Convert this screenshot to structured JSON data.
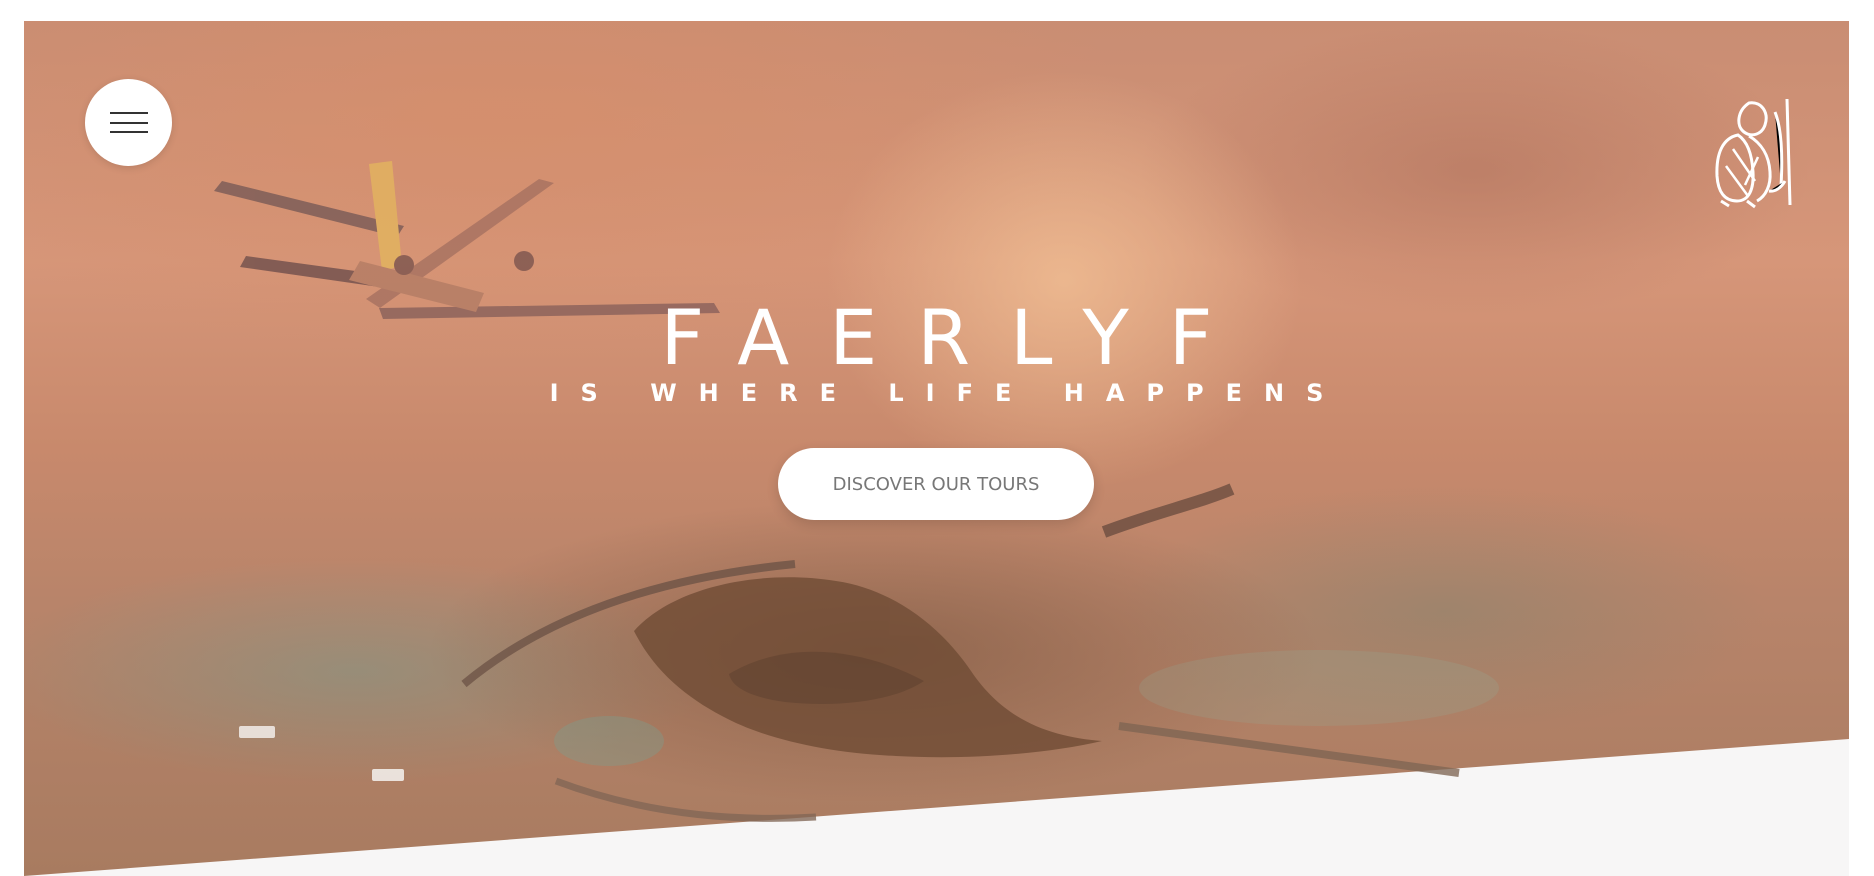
{
  "header": {
    "menu_button_label": "",
    "logo_icon": "hiker-backpack-logo"
  },
  "hero": {
    "title": "FAERLYF",
    "subtitle": "IS WHERE LIFE HAPPENS",
    "cta_label": "DISCOVER OUR TOURS"
  },
  "colors": {
    "overlay": "#d69679",
    "cta_background": "#ffffff",
    "cta_text": "#777777",
    "page_background": "#f7f6f6"
  }
}
